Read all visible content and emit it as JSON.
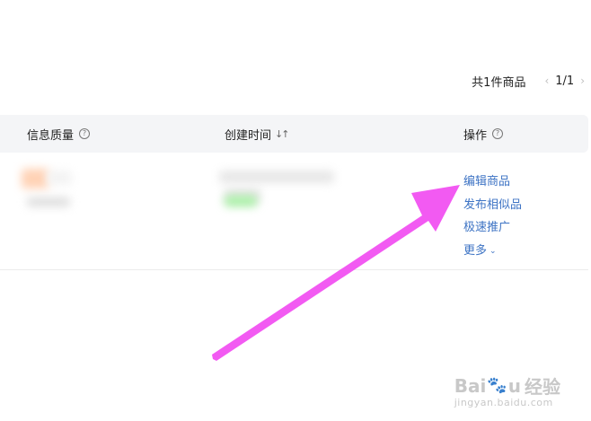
{
  "pagination": {
    "total_text": "共1件商品",
    "prev_icon": "‹",
    "page_text": "1/1",
    "next_icon": "›"
  },
  "table": {
    "headers": {
      "quality": "信息质量",
      "created": "创建时间",
      "actions": "操作"
    },
    "row": {
      "actions": {
        "edit": "编辑商品",
        "publish_similar": "发布相似品",
        "quick_promote": "极速推广",
        "more": "更多"
      }
    }
  },
  "annotation": {
    "arrow_color": "#f25af2"
  },
  "watermark": {
    "brand": "Baidu",
    "product": "经验",
    "url": "jingyan.baidu.com"
  }
}
